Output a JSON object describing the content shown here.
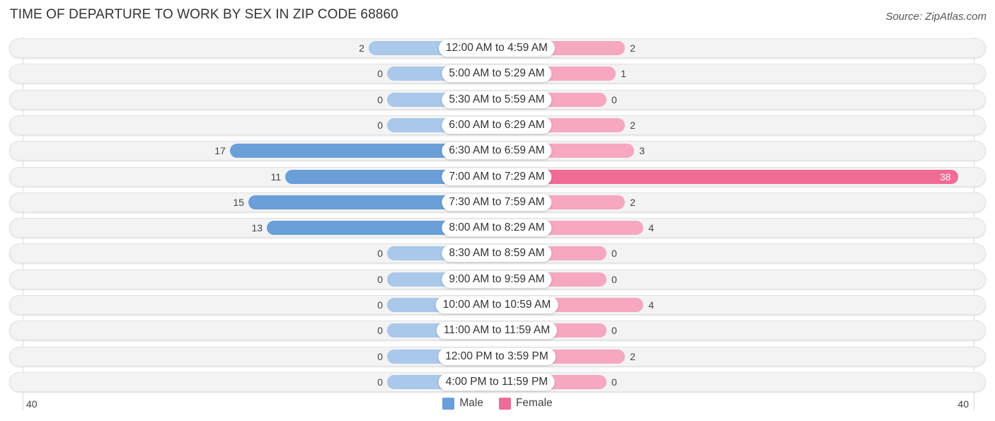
{
  "header": {
    "title": "TIME OF DEPARTURE TO WORK BY SEX IN ZIP CODE 68860",
    "source": "Source: ZipAtlas.com"
  },
  "colors": {
    "male_strong": "#6a9fd8",
    "male_light": "#a9c8ea",
    "female_strong": "#f06b95",
    "female_light": "#f5a8c0"
  },
  "chart_data": {
    "type": "bar",
    "orientation": "horizontal-diverging",
    "title": "TIME OF DEPARTURE TO WORK BY SEX IN ZIP CODE 68860",
    "categories": [
      "12:00 AM to 4:59 AM",
      "5:00 AM to 5:29 AM",
      "5:30 AM to 5:59 AM",
      "6:00 AM to 6:29 AM",
      "6:30 AM to 6:59 AM",
      "7:00 AM to 7:29 AM",
      "7:30 AM to 7:59 AM",
      "8:00 AM to 8:29 AM",
      "8:30 AM to 8:59 AM",
      "9:00 AM to 9:59 AM",
      "10:00 AM to 10:59 AM",
      "11:00 AM to 11:59 AM",
      "12:00 PM to 3:59 PM",
      "4:00 PM to 11:59 PM"
    ],
    "series": [
      {
        "name": "Male",
        "values": [
          2,
          0,
          0,
          0,
          17,
          11,
          15,
          13,
          0,
          0,
          0,
          0,
          0,
          0
        ]
      },
      {
        "name": "Female",
        "values": [
          2,
          1,
          0,
          2,
          3,
          38,
          2,
          4,
          0,
          0,
          4,
          0,
          2,
          0
        ]
      }
    ],
    "axis": {
      "left_tick": "40",
      "right_tick": "40",
      "range": [
        -40,
        40
      ]
    },
    "legend": {
      "position": "bottom-center",
      "entries": [
        "Male",
        "Female"
      ]
    },
    "grid": false
  }
}
